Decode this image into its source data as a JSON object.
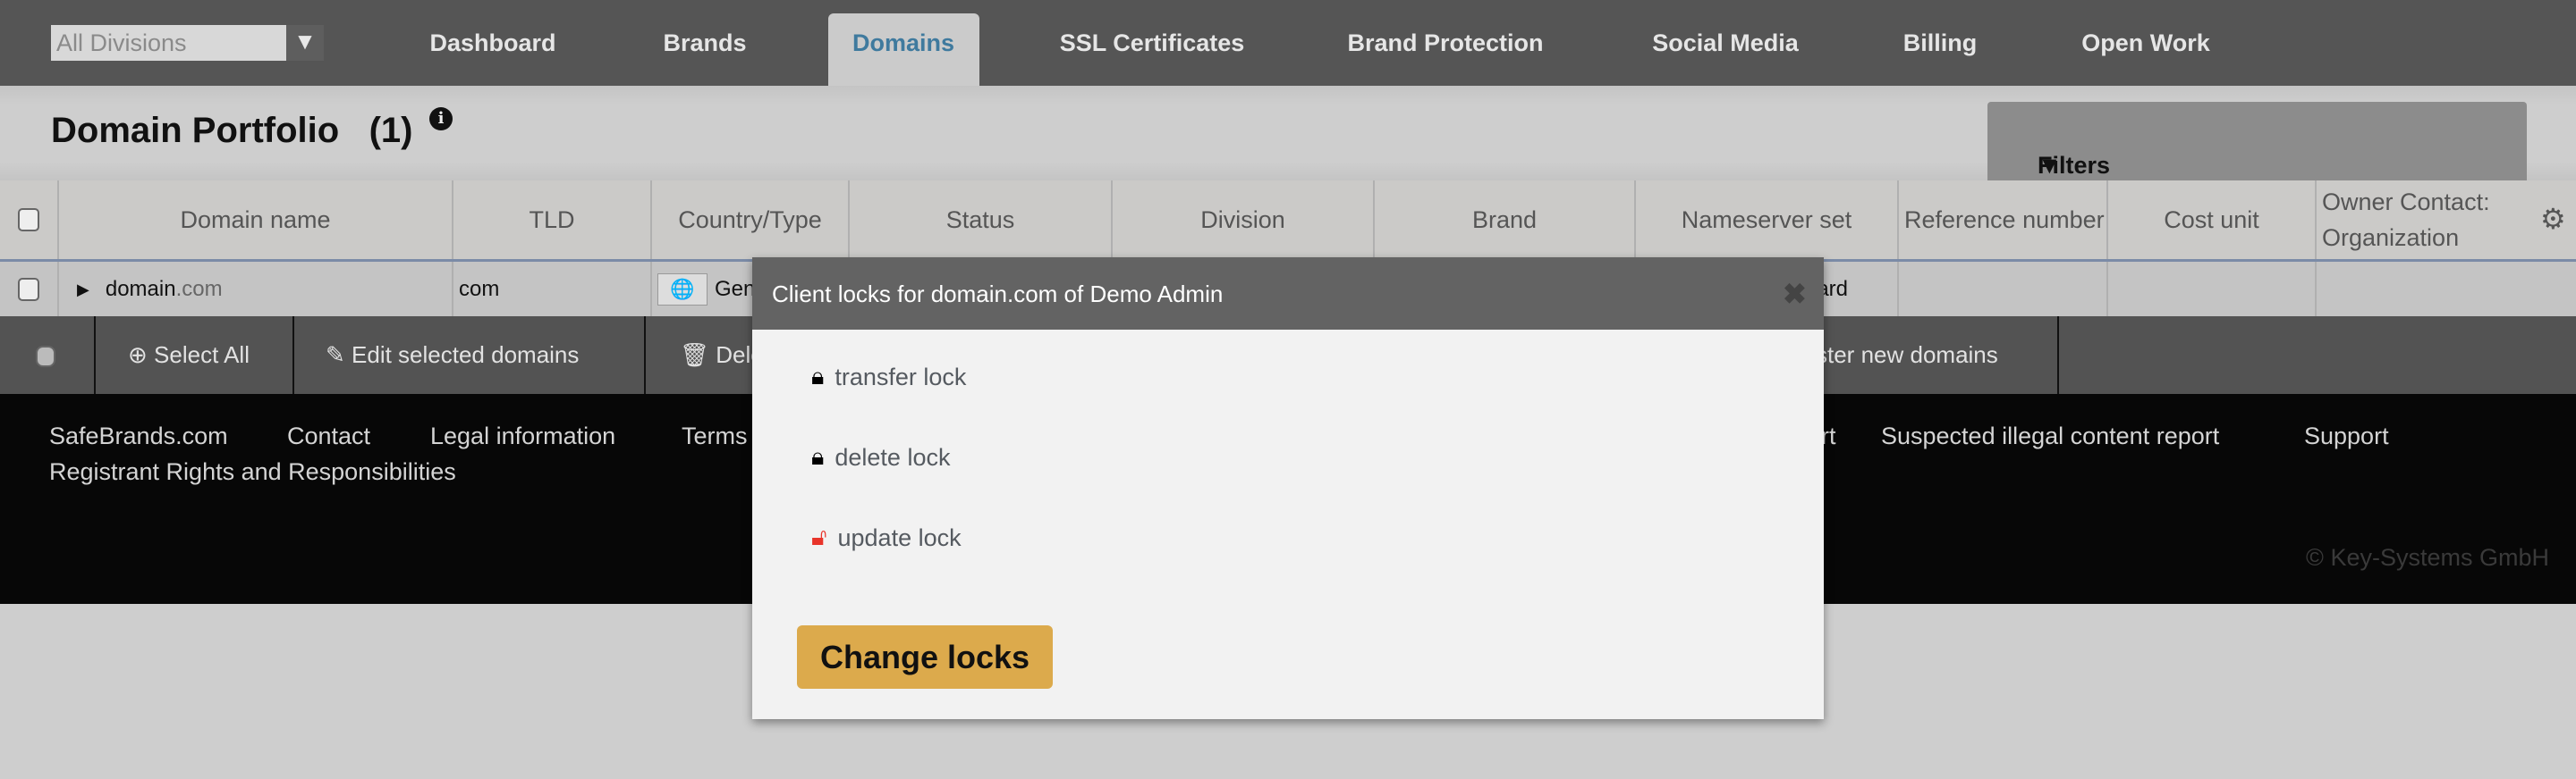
{
  "nav": {
    "division_select": "All Divisions",
    "tabs": [
      "Dashboard",
      "Brands",
      "Domains",
      "SSL Certificates",
      "Brand Protection",
      "Social Media",
      "Billing",
      "Open Work"
    ],
    "active_tab": "Domains"
  },
  "page": {
    "title": "Domain Portfolio",
    "count": "(1)",
    "filters_label": "Filters"
  },
  "table": {
    "headers": [
      "Domain name",
      "TLD",
      "Country/Type",
      "Status",
      "Division",
      "Brand",
      "Nameserver set",
      "Reference number",
      "Cost unit",
      "Owner Contact: Organization"
    ],
    "rows": [
      {
        "domain": "domain",
        "domain_tld_suffix": ".com",
        "tld": "com",
        "country_type": "Generic",
        "nameserver_set": "ard"
      }
    ]
  },
  "actions": {
    "select_all": "Select All",
    "edit": "Edit selected domains",
    "delete": "Dele",
    "register": "ster new domains"
  },
  "footer": {
    "links": [
      "SafeBrands.com",
      "Contact",
      "Legal information",
      "Terms",
      "rt",
      "Suspected illegal content report",
      "Support",
      "Registrant Rights and Responsibilities"
    ],
    "copyright": "© Key-Systems GmbH"
  },
  "modal": {
    "title": "Client locks for domain.com of Demo Admin",
    "locks": [
      {
        "label": "transfer lock",
        "locked": true
      },
      {
        "label": "delete lock",
        "locked": true
      },
      {
        "label": "update lock",
        "locked": false
      }
    ],
    "button": "Change locks"
  },
  "colors": {
    "accent_button": "#dcaa4c",
    "unlocked": "#e8342a",
    "active_tab_text": "#3f7a9e"
  }
}
